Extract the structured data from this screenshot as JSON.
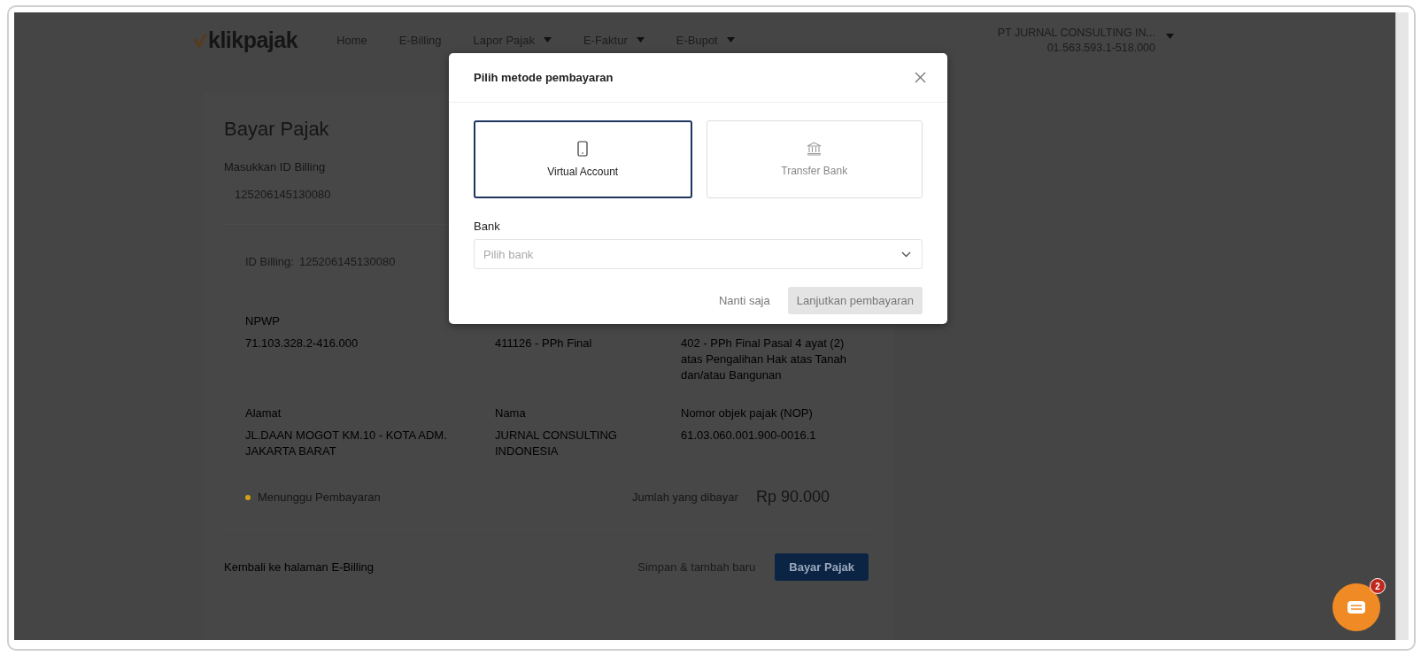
{
  "header": {
    "logo": "klikpajak",
    "nav": [
      {
        "label": "Home",
        "dropdown": false
      },
      {
        "label": "E-Billing",
        "dropdown": false
      },
      {
        "label": "Lapor Pajak",
        "dropdown": true
      },
      {
        "label": "E-Faktur",
        "dropdown": true
      },
      {
        "label": "E-Bupot",
        "dropdown": true
      }
    ],
    "account": {
      "name": "PT JURNAL CONSULTING IN...",
      "npwp": "01.563.593.1-518.000"
    }
  },
  "page": {
    "title": "Bayar Pajak",
    "billing_input": {
      "label": "Masukkan ID Billing",
      "value": "125206145130080"
    },
    "summary": {
      "id_label": "ID Billing:",
      "id_value": "125206145130080",
      "fields": [
        {
          "label": "NPWP",
          "value": "71.103.328.2-416.000"
        },
        {
          "value": "411126 - PPh Final"
        },
        {
          "value": "402 - PPh Final Pasal 4 ayat (2) atas Pengalihan Hak atas Tanah dan/atau Bangunan"
        },
        {
          "label": "Alamat",
          "value": "JL.DAAN MOGOT KM.10 - KOTA ADM. JAKARTA BARAT"
        },
        {
          "label": "Nama",
          "value": "JURNAL CONSULTING INDONESIA"
        },
        {
          "label": "Nomor objek pajak (NOP)",
          "value": "61.03.060.001.900-0016.1"
        }
      ],
      "status": {
        "label": "Menunggu Pembayaran",
        "color": "#d4a017"
      },
      "total": {
        "label": "Jumlah yang dibayar",
        "amount": "Rp 90.000"
      }
    },
    "footer": {
      "back_link": "Kembali ke halaman E-Billing",
      "save_button": "Simpan & tambah baru",
      "pay_button": "Bayar Pajak"
    }
  },
  "modal": {
    "title": "Pilih metode pembayaran",
    "methods": [
      {
        "label": "Virtual Account",
        "kind": "phone",
        "selected": true
      },
      {
        "label": "Transfer Bank",
        "kind": "bank",
        "selected": false
      }
    ],
    "bank_field": {
      "label": "Bank",
      "placeholder": "Pilih bank"
    },
    "cancel": "Nanti saja",
    "confirm": {
      "label": "Lanjutkan pembayaran",
      "disabled": true
    }
  },
  "chat": {
    "badge": "2"
  }
}
